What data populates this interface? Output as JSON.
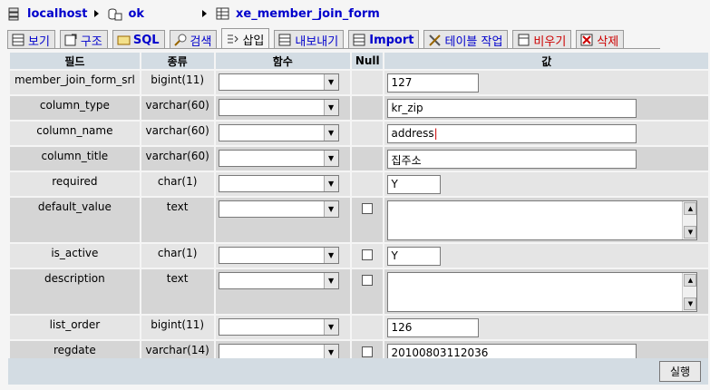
{
  "breadcrumb": {
    "server": "localhost",
    "database": "ok",
    "table": "xe_member_join_form"
  },
  "tabs": [
    {
      "label": "보기",
      "icon": "browse-icon",
      "active": false
    },
    {
      "label": "구조",
      "icon": "structure-icon",
      "active": false
    },
    {
      "label": "SQL",
      "icon": "sql-icon",
      "active": false
    },
    {
      "label": "검색",
      "icon": "search-icon",
      "active": false
    },
    {
      "label": "삽입",
      "icon": "insert-icon",
      "active": true
    },
    {
      "label": "내보내기",
      "icon": "export-icon",
      "active": false
    },
    {
      "label": "Import",
      "icon": "import-icon",
      "active": false
    },
    {
      "label": "테이블 작업",
      "icon": "operations-icon",
      "active": false
    },
    {
      "label": "비우기",
      "icon": "empty-icon",
      "active": false
    },
    {
      "label": "삭제",
      "icon": "drop-icon",
      "active": false
    }
  ],
  "columns": {
    "field": "필드",
    "type": "종류",
    "function": "함수",
    "null": "Null",
    "value": "값"
  },
  "rows": [
    {
      "field": "member_join_form_srl",
      "type": "bigint(11)",
      "value": "127",
      "nullable": false,
      "input": "short"
    },
    {
      "field": "column_type",
      "type": "varchar(60)",
      "value": "kr_zip",
      "nullable": false,
      "input": "long"
    },
    {
      "field": "column_name",
      "type": "varchar(60)",
      "value": "address",
      "nullable": false,
      "input": "long"
    },
    {
      "field": "column_title",
      "type": "varchar(60)",
      "value": "집주소",
      "nullable": false,
      "input": "long"
    },
    {
      "field": "required",
      "type": "char(1)",
      "value": "Y",
      "nullable": false,
      "input": "tiny"
    },
    {
      "field": "default_value",
      "type": "text",
      "value": "",
      "nullable": true,
      "input": "textarea"
    },
    {
      "field": "is_active",
      "type": "char(1)",
      "value": "Y",
      "nullable": true,
      "input": "tiny"
    },
    {
      "field": "description",
      "type": "text",
      "value": "",
      "nullable": true,
      "input": "textarea"
    },
    {
      "field": "list_order",
      "type": "bigint(11)",
      "value": "126",
      "nullable": false,
      "input": "short"
    },
    {
      "field": "regdate",
      "type": "varchar(14)",
      "value": "20100803112036",
      "nullable": true,
      "input": "long"
    }
  ],
  "submit_label": "실행",
  "colors": {
    "header_bg": "#d3dce3",
    "row_odd": "#e5e5e5",
    "row_even": "#d5d5d5",
    "link": "#0000cc",
    "danger": "#cc0000"
  }
}
